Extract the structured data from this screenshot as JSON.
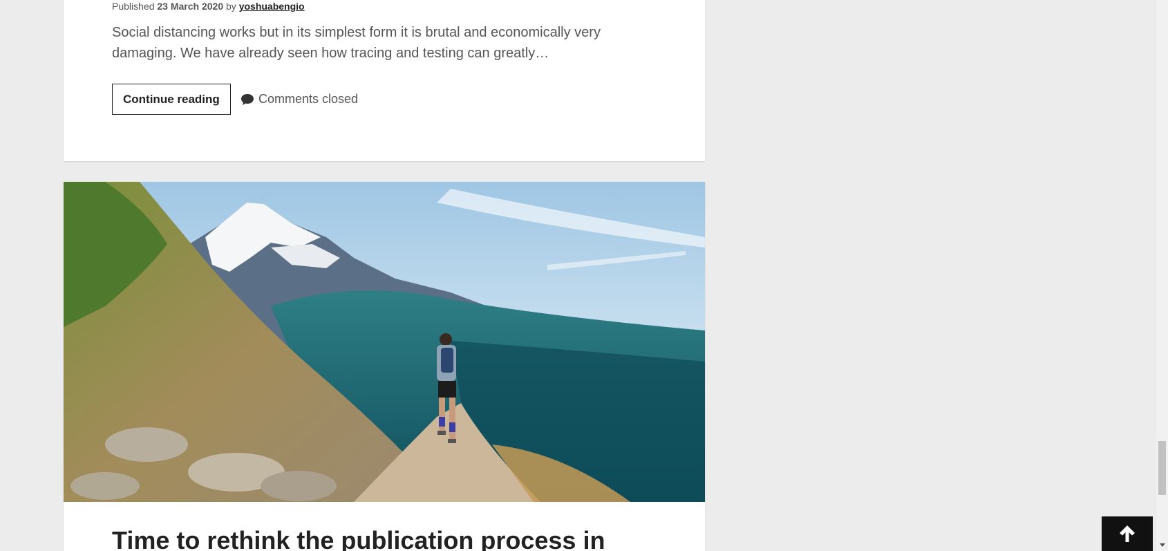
{
  "post_top": {
    "meta_published": "Published",
    "meta_date": "23 March 2020",
    "meta_by": "by",
    "meta_author": "yoshuabengio",
    "excerpt": "Social distancing works but in its simplest form it is brutal and economically very damaging. We have already seen how tracing and testing can greatly…",
    "continue_label": "Continue reading",
    "comments_label": "Comments closed",
    "comments_icon": "comment-icon"
  },
  "post_next": {
    "image_subject": "trail runner on mountain path with snowy peak and forest valley",
    "title": "Time to rethink the publication process in"
  },
  "controls": {
    "back_to_top_icon": "arrow-up-icon"
  },
  "colors": {
    "page_background": "#ececec",
    "card_background": "#ffffff",
    "text_primary": "#222222",
    "text_secondary": "#555555",
    "back_to_top_bg": "#111111"
  }
}
